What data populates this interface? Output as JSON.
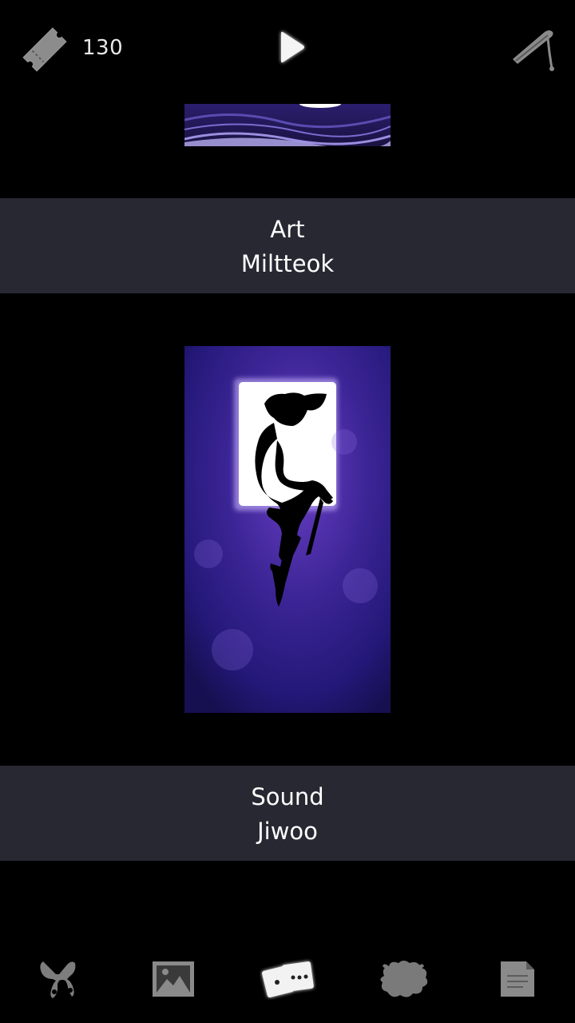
{
  "header": {
    "ticket_icon": "ticket-icon",
    "ticket_count": "130",
    "play_icon": "play-icon",
    "quill_icon": "quill-pen-icon"
  },
  "credits": [
    {
      "role": "Art",
      "name": "Miltteok"
    },
    {
      "role": "Sound",
      "name": "Jiwoo"
    }
  ],
  "bottom_nav": {
    "items": [
      {
        "icon": "scissors-icon",
        "active": false
      },
      {
        "icon": "gallery-icon",
        "active": false
      },
      {
        "icon": "cards-icon",
        "active": true
      },
      {
        "icon": "sheep-icon",
        "active": false
      },
      {
        "icon": "notes-icon",
        "active": false
      }
    ]
  },
  "colors": {
    "background": "#000000",
    "band": "#282833",
    "icon_inactive": "#8a8a8a",
    "icon_active": "#f2f2f2",
    "art_purple": "#4a2fa0"
  }
}
